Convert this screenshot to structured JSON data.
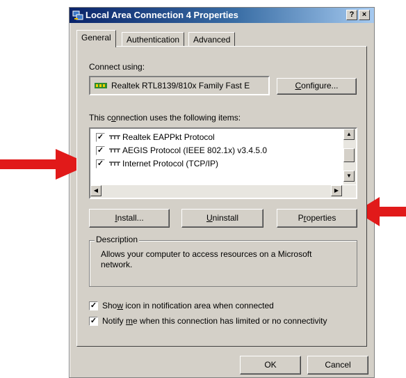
{
  "window": {
    "title": "Local Area Connection 4 Properties",
    "help_label": "?",
    "close_label": "×"
  },
  "tabs": [
    {
      "label": "General"
    },
    {
      "label": "Authentication"
    },
    {
      "label": "Advanced"
    }
  ],
  "general": {
    "connect_using_label": "Connect using:",
    "adapter_name": "Realtek RTL8139/810x Family Fast E",
    "configure_pre": "C",
    "configure_post": "onfigure...",
    "items_pre": "This c",
    "items_u": "o",
    "items_post": "nnection uses the following items:",
    "items": [
      {
        "label": "Realtek EAPPkt Protocol",
        "checked": true
      },
      {
        "label": "AEGIS Protocol (IEEE 802.1x) v3.4.5.0",
        "checked": true
      },
      {
        "label": "Internet Protocol (TCP/IP)",
        "checked": true
      }
    ],
    "install_pre": "I",
    "install_post": "nstall...",
    "uninstall_pre": "U",
    "uninstall_post": "ninstall",
    "properties_pre": "P",
    "properties_u": "r",
    "properties_post": "operties",
    "description_label": "Description",
    "description_text": "Allows your computer to access resources on a Microsoft network.",
    "show_icon_pre": "Sho",
    "show_icon_u": "w",
    "show_icon_post": " icon in notification area when connected",
    "notify_pre": "Notify ",
    "notify_u": "m",
    "notify_post": "e when this connection has limited or no connectivity",
    "check_mark": "✓"
  },
  "footer": {
    "ok_label": "OK",
    "cancel_label": "Cancel"
  },
  "colors": {
    "highlight_red": "#e11a1a",
    "title_blue": "#0a246a"
  }
}
